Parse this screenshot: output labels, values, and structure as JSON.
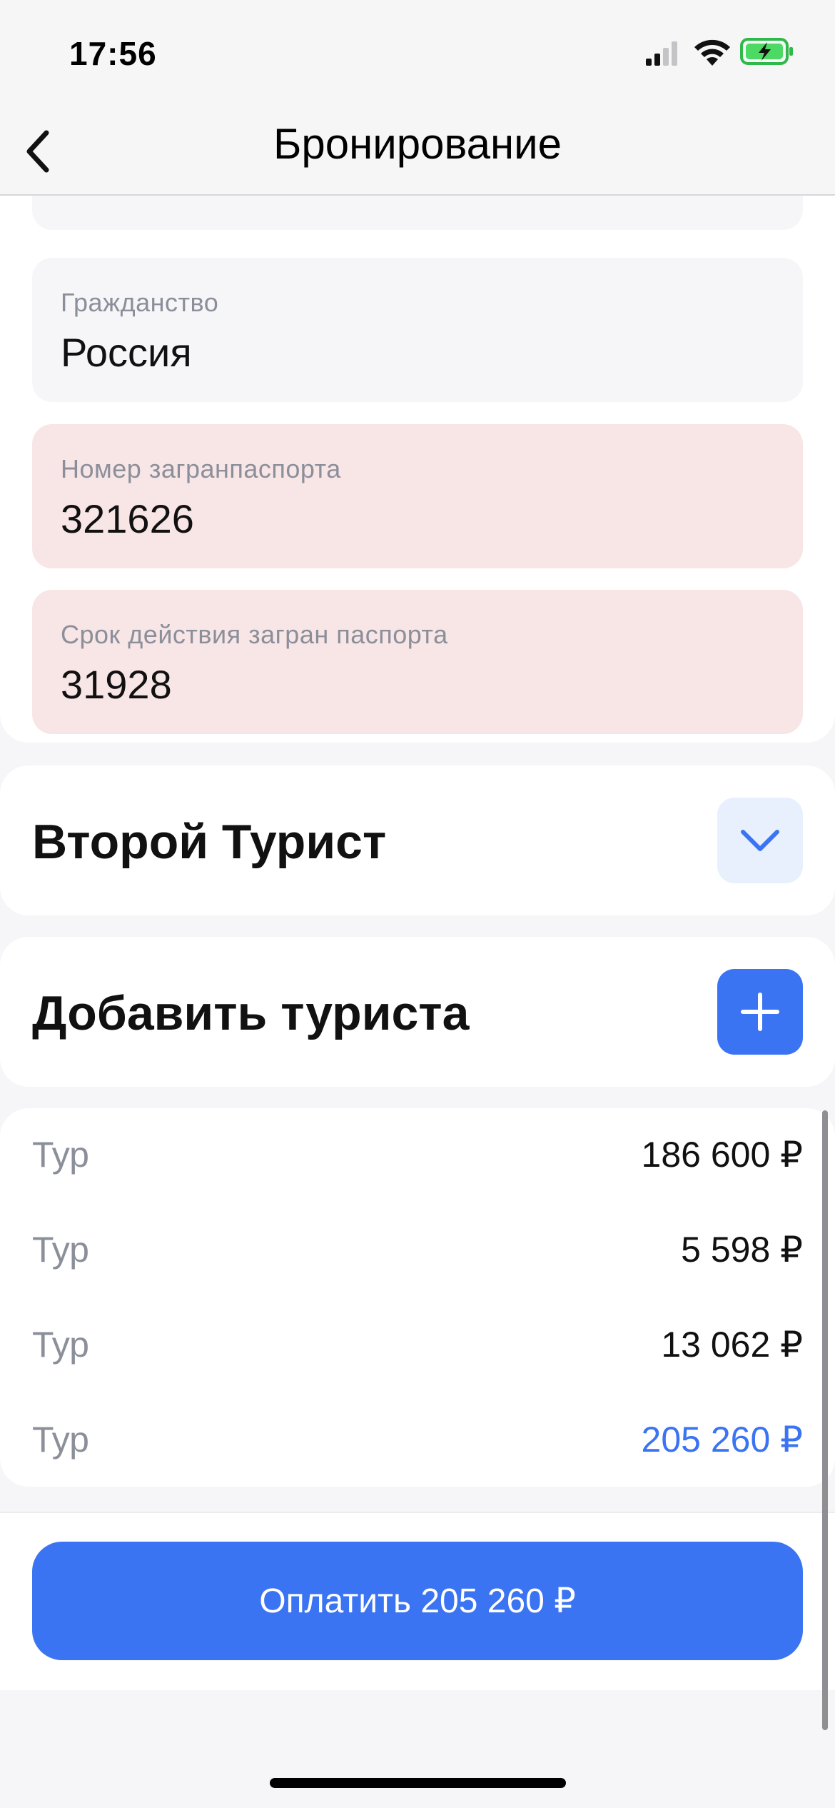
{
  "status_bar": {
    "time": "17:56"
  },
  "nav": {
    "title": "Бронирование"
  },
  "fields": {
    "citizenship": {
      "label": "Гражданство",
      "value": "Россия"
    },
    "passport_number": {
      "label": "Номер загранпаспорта",
      "value": "321626"
    },
    "passport_expiry": {
      "label": "Срок действия загран паспорта",
      "value": "31928"
    }
  },
  "second_tourist": {
    "title": "Второй Турист"
  },
  "add_tourist": {
    "title": "Добавить туриста"
  },
  "prices": [
    {
      "label": "Тур",
      "value": "186 600 ₽"
    },
    {
      "label": "Тур",
      "value": "5 598 ₽"
    },
    {
      "label": "Тур",
      "value": "13 062 ₽"
    },
    {
      "label": "Тур",
      "value": "205 260 ₽"
    }
  ],
  "pay_button": {
    "label": "Оплатить 205 260 ₽"
  },
  "colors": {
    "accent": "#3b74f2",
    "error_bg": "#f8e5e6",
    "field_bg": "#f6f6f9",
    "muted_text": "#8b8f9a"
  }
}
